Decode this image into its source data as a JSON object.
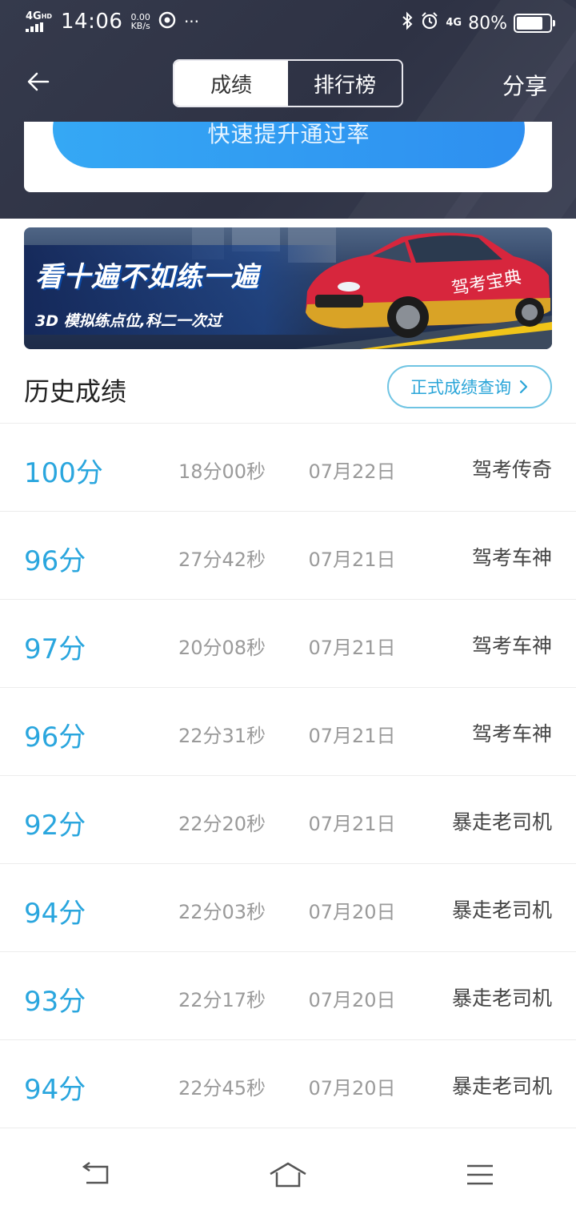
{
  "status_bar": {
    "network": "4G",
    "network_sup": "HD",
    "time": "14:06",
    "speed_value": "0.00",
    "speed_unit": "KB/s",
    "more": "···",
    "right_network": "4G",
    "battery": "80%",
    "battery_level": 0.8
  },
  "navbar": {
    "tabs": [
      {
        "label": "成绩",
        "active": true
      },
      {
        "label": "排行榜",
        "active": false
      }
    ],
    "share_label": "分享"
  },
  "promo": {
    "button_label": "快速提升通过率"
  },
  "banner": {
    "headline": "看十遍不如练一遍",
    "subline": "3D 模拟练点位,科二一次过",
    "car_plate": "驾考宝典"
  },
  "history": {
    "title": "历史成绩",
    "query_button": "正式成绩查询"
  },
  "records": [
    {
      "score": "100分",
      "duration": "18分00秒",
      "date": "07月22日",
      "title": "驾考传奇"
    },
    {
      "score": "96分",
      "duration": "27分42秒",
      "date": "07月21日",
      "title": "驾考车神"
    },
    {
      "score": "97分",
      "duration": "20分08秒",
      "date": "07月21日",
      "title": "驾考车神"
    },
    {
      "score": "96分",
      "duration": "22分31秒",
      "date": "07月21日",
      "title": "驾考车神"
    },
    {
      "score": "92分",
      "duration": "22分20秒",
      "date": "07月21日",
      "title": "暴走老司机"
    },
    {
      "score": "94分",
      "duration": "22分03秒",
      "date": "07月20日",
      "title": "暴走老司机"
    },
    {
      "score": "93分",
      "duration": "22分17秒",
      "date": "07月20日",
      "title": "暴走老司机"
    },
    {
      "score": "94分",
      "duration": "22分45秒",
      "date": "07月20日",
      "title": "暴走老司机"
    }
  ],
  "colors": {
    "accent": "#2aa6de",
    "header_bg": "#353a4c",
    "promo_button": "#35a8f4"
  },
  "icons": {
    "back": "arrow-left-icon",
    "query_chevron": "chevron-right-icon",
    "nav_back": "return-icon",
    "nav_home": "home-icon",
    "nav_menu": "menu-icon"
  }
}
